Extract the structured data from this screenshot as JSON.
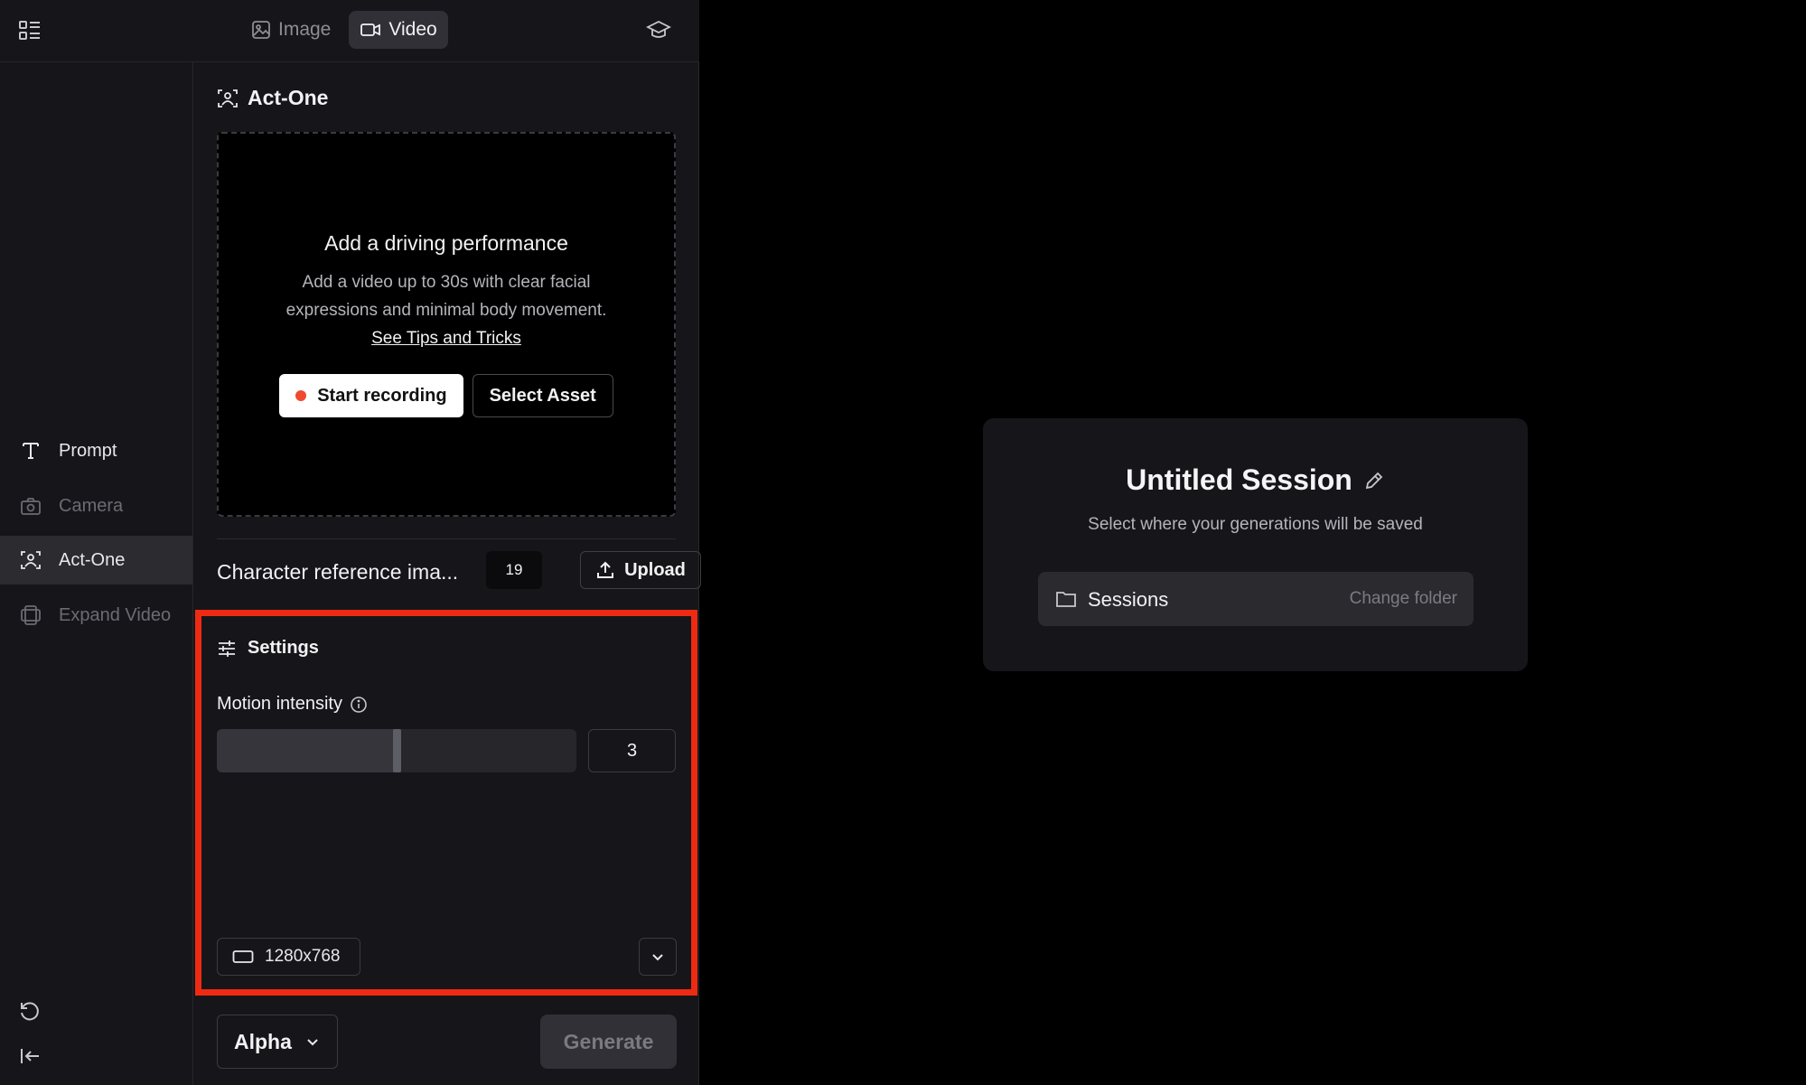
{
  "topbar": {
    "tabs": [
      {
        "label": "Image",
        "icon": "image-icon",
        "active": false
      },
      {
        "label": "Video",
        "icon": "video-icon",
        "active": true
      }
    ]
  },
  "sidebar": {
    "items": [
      {
        "label": "Prompt",
        "icon": "text-icon",
        "state": "normal"
      },
      {
        "label": "Camera",
        "icon": "camera-icon",
        "state": "disabled"
      },
      {
        "label": "Act-One",
        "icon": "face-scan-icon",
        "state": "active"
      },
      {
        "label": "Expand Video",
        "icon": "expand-frame-icon",
        "state": "disabled"
      }
    ]
  },
  "panel": {
    "title": "Act-One",
    "dropzone": {
      "title": "Add a driving performance",
      "description": "Add a video up to 30s with clear facial expressions and minimal body movement.",
      "link": "See Tips and Tricks",
      "record_label": "Start recording",
      "asset_label": "Select Asset"
    },
    "character_reference": {
      "label": "Character reference ima...",
      "count": "19",
      "upload_label": "Upload"
    },
    "settings": {
      "title": "Settings",
      "motion_label": "Motion intensity",
      "motion_value": "3",
      "motion_fraction": 0.5,
      "resolution": "1280x768"
    },
    "model": "Alpha",
    "generate_label": "Generate"
  },
  "session": {
    "title": "Untitled Session",
    "subtitle": "Select where your generations will be saved",
    "folder": "Sessions",
    "change_folder": "Change folder"
  },
  "colors": {
    "highlight": "#ee2a12",
    "record_dot": "#ef4a2f",
    "panel_bg": "#16161a"
  }
}
